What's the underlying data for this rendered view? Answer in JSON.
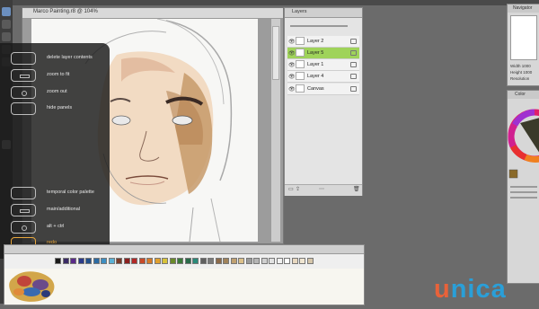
{
  "canvas_window": {
    "title": "Marco Painting.r8 @ 104%"
  },
  "overlay": {
    "items": [
      {
        "label": "delete layer contents",
        "accent": false
      },
      {
        "label": "zoom to fit",
        "accent": false
      },
      {
        "label": "zoom out",
        "accent": false
      },
      {
        "label": "hide panels",
        "accent": false
      },
      {
        "label": "temporal color palette",
        "accent": false
      },
      {
        "label": "main/additional",
        "accent": false
      },
      {
        "label": "alt + ctrl",
        "accent": false
      },
      {
        "label": "redo",
        "accent": true
      }
    ]
  },
  "layers_panel": {
    "title": "Layers",
    "layers": [
      {
        "name": "Layer 2",
        "selected": false
      },
      {
        "name": "Layer 5",
        "selected": true
      },
      {
        "name": "Layer 1",
        "selected": false
      },
      {
        "name": "Layer 4",
        "selected": false
      },
      {
        "name": "Canvas",
        "selected": false
      }
    ]
  },
  "navigator_panel": {
    "title": "Navigator",
    "width_label": "Width",
    "width_value": "1000",
    "height_label": "Height",
    "height_value": "1000",
    "resolution_label": "Resolution"
  },
  "color_panel": {
    "title": "Color"
  },
  "palette": {
    "swatches": [
      "#1a1a1a",
      "#3a2a66",
      "#5a2a8a",
      "#2a3a8a",
      "#23508c",
      "#2b6aa3",
      "#3d8ec2",
      "#5ab0d6",
      "#7a3a2a",
      "#8c2020",
      "#b32828",
      "#c84a2a",
      "#d67a2a",
      "#e0a030",
      "#d8c23a",
      "#6a8a2a",
      "#3a7a3a",
      "#2a6a4a",
      "#2a8a7a",
      "#606060",
      "#7a7a7a",
      "#8c6a4a",
      "#a0825a",
      "#c0a070",
      "#dcc08a",
      "#9a9a9a",
      "#b5b5b5",
      "#cfcfcf",
      "#e2e2e2",
      "#f2f2f2",
      "#ffffff",
      "#e8d8c0",
      "#f0e6d2",
      "#d6c6aa"
    ]
  },
  "logo": {
    "first": "u",
    "rest": "nica"
  },
  "colors": {
    "selected_layer": "#9fd35a",
    "accent": "#e8a73c"
  }
}
